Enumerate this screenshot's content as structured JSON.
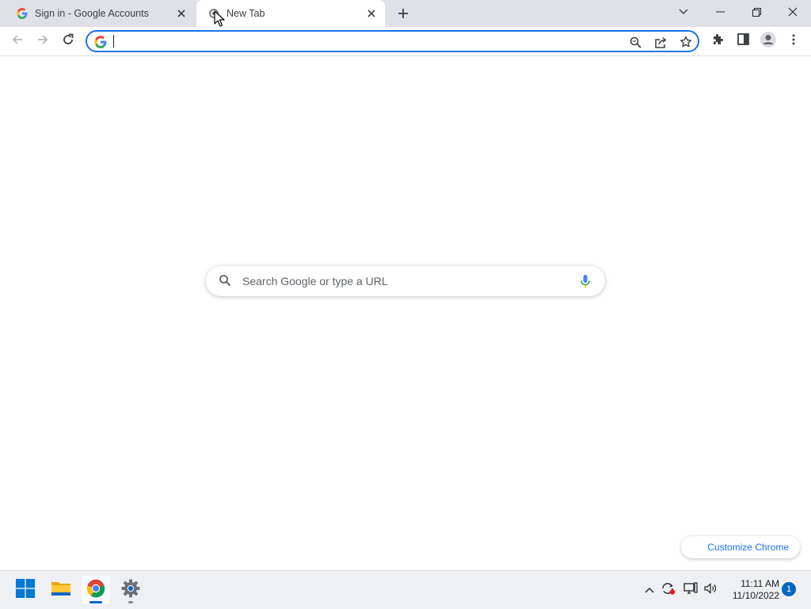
{
  "browser": {
    "tabs": [
      {
        "title": "Sign in - Google Accounts",
        "favicon": "google-g-icon",
        "active": false
      },
      {
        "title": "New Tab",
        "favicon": "chrome-newtab-icon",
        "active": true
      }
    ],
    "omnibox": {
      "value": "",
      "placeholder": ""
    }
  },
  "ntp": {
    "search_placeholder": "Search Google or type a URL",
    "customize_label": "Customize Chrome"
  },
  "taskbar": {
    "time": "11:11 AM",
    "date": "11/10/2022",
    "notification_count": "1",
    "apps": [
      "start-icon",
      "file-explorer-icon",
      "chrome-icon",
      "settings-icon"
    ]
  },
  "colors": {
    "accent": "#1a73e8",
    "tabstrip": "#dee1e6",
    "taskbar_accent": "#0067c0"
  }
}
